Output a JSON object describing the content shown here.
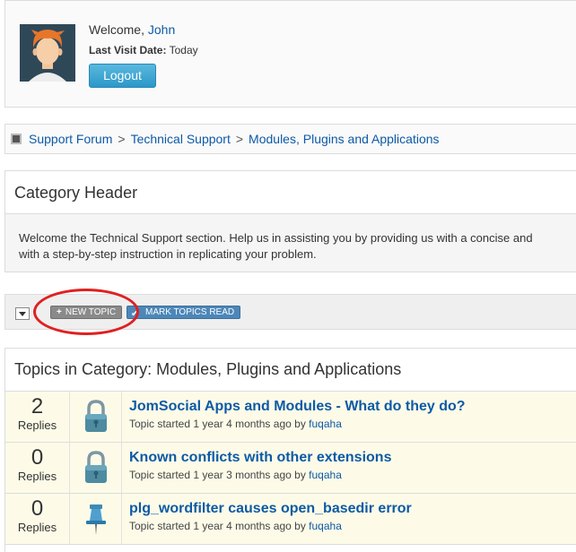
{
  "user": {
    "welcome": "Welcome,",
    "name": "John",
    "last_visit_label": "Last Visit Date:",
    "last_visit_value": "Today",
    "logout_label": "Logout"
  },
  "breadcrumb": {
    "items": [
      "Support Forum",
      "Technical Support",
      "Modules, Plugins and Applications"
    ],
    "separator": ">"
  },
  "category": {
    "header": "Category Header",
    "description_line1": "Welcome the Technical Support section. Help us in assisting you by providing us with a concise and",
    "description_line2": "with a step-by-step instruction in replicating your problem."
  },
  "toolbar": {
    "new_topic_label": "NEW TOPIC",
    "mark_read_label": "MARK TOPICS READ"
  },
  "topics": {
    "title": "Topics in Category: Modules, Plugins and Applications",
    "replies_label": "Replies",
    "started_prefix": "Topic started",
    "by_label": "by",
    "items": [
      {
        "replies": "2",
        "title": "JomSocial Apps and Modules - What do they do?",
        "age": "1 year 4 months ago",
        "author": "fuqaha",
        "icon": "lock-icon"
      },
      {
        "replies": "0",
        "title": "Known conflicts with other extensions",
        "age": "1 year 3 months ago",
        "author": "fuqaha",
        "icon": "lock-icon"
      },
      {
        "replies": "0",
        "title": "plg_wordfilter causes open_basedir error",
        "age": "1 year 4 months ago",
        "author": "fuqaha",
        "icon": "pin-icon"
      }
    ]
  },
  "colors": {
    "link": "#0c5aa6",
    "logout_button": "#2b98c8",
    "highlight_oval": "#e02020",
    "topic_row_bg": "#fdfbe8"
  }
}
